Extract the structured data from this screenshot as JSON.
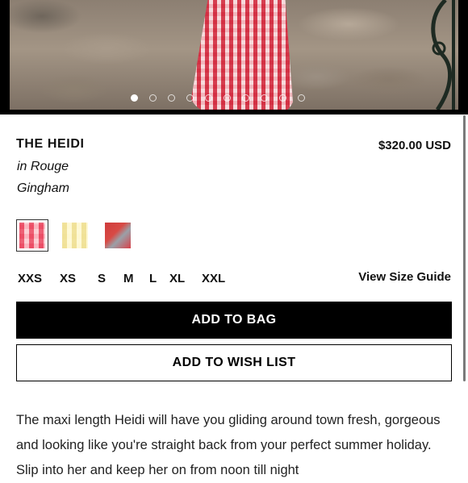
{
  "product": {
    "title": "THE HEIDI",
    "price": "$320.00 USD",
    "subtitle": "in Rouge Gingham",
    "gallery": {
      "image_count": 10,
      "active_index": 0
    }
  },
  "swatches": [
    {
      "name": "rouge-gingham",
      "selected": true,
      "color": "#f4a9b3"
    },
    {
      "name": "yellow-gingham",
      "selected": false,
      "color": "#f6eab4"
    },
    {
      "name": "red-print",
      "selected": false,
      "color": "#cf3b3b"
    }
  ],
  "sizes": [
    "XXS",
    "XS",
    "S",
    "M",
    "L",
    "XL",
    "XXL"
  ],
  "size_guide_label": "View Size Guide",
  "buttons": {
    "add_to_bag": "ADD TO BAG",
    "add_to_wish_list": "ADD TO WISH LIST"
  },
  "description": "The maxi length Heidi will have you gliding around town fresh, gorgeous and looking like you're straight back from your perfect summer holiday. Slip into her and keep her on from noon till night"
}
